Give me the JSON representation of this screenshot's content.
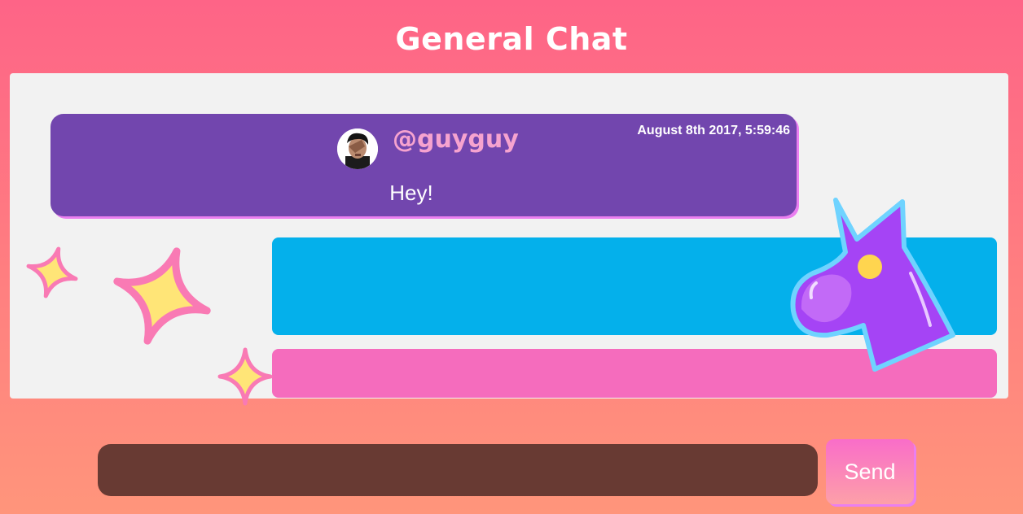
{
  "header": {
    "title": "General Chat"
  },
  "messages": [
    {
      "username": "@guyguy",
      "timestamp": "August 8th 2017, 5:59:46",
      "text": "Hey!",
      "bubble_color": "#7246ae"
    },
    {
      "bubble_color": "#04b0eb"
    },
    {
      "bubble_color": "#f56cbd"
    }
  ],
  "composer": {
    "input_value": "",
    "send_label": "Send"
  },
  "decorations": {
    "sparkle_icon": "sparkle-icon",
    "unicorn_icon": "unicorn-icon"
  },
  "colors": {
    "background_top": "#fe6487",
    "background_bottom": "#ff957b",
    "panel": "#f2f2f2",
    "input": "#683a33",
    "sparkle_fill": "#ffe577",
    "sparkle_outline": "#f97ab4",
    "unicorn": "#a544f5"
  }
}
